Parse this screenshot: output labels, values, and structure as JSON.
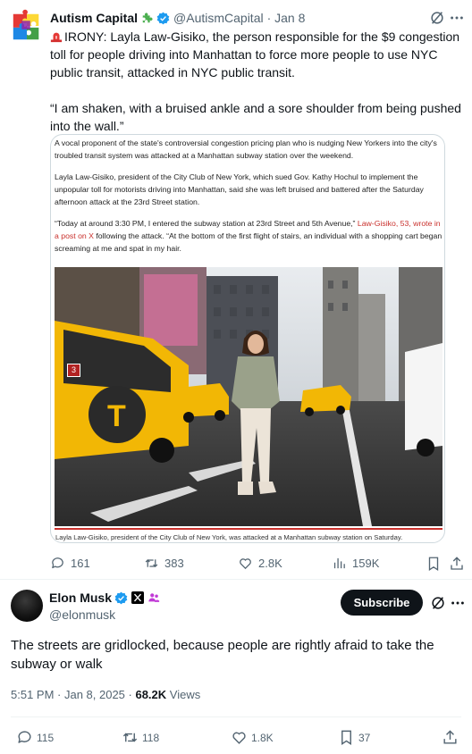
{
  "quoted_tweet": {
    "author_name": "Autism Capital",
    "author_emoji": "puzzle-piece-icon",
    "handle": "@AutismCapital",
    "date": "· Jan 8",
    "text_line1": "IRONY: Layla Law-Gisiko, the person responsible for the $9 congestion toll for people driving into Manhattan to force more people to use NYC public transit, attacked in NYC public transit.",
    "text_line2": "“I am shaken, with a bruised ankle and a sore shoulder from being pushed into the wall.”",
    "article": {
      "p1": "A vocal proponent of the state's controversial congestion pricing plan who is nudging New Yorkers into the city's troubled transit system was attacked at a Manhattan subway station over the weekend.",
      "p2": "Layla Law-Gisiko, president of the City Club of New York, which sued Gov. Kathy Hochul to implement the unpopular toll for motorists driving into Manhattan, said she was left bruised and battered after the Saturday afternoon attack at the 23rd Street station.",
      "p3_start": "“Today at around 3:30 PM, I entered the subway station at 23rd Street and 5th Avenue,”",
      "p3_link": "Law-Gisiko, 53, wrote in a post on X",
      "p3_end": "following the attack. “At the bottom of the first flight of stairs, an individual with a shopping cart began screaming at me and spat in my hair.",
      "photo_badge": "3",
      "caption": "Layla Law-Gisiko, president of the City Club of New York, was attacked at a Manhattan subway station on Saturday."
    },
    "stats": {
      "replies": "161",
      "reposts": "383",
      "likes": "2.8K",
      "views": "159K"
    }
  },
  "main_tweet": {
    "author_name": "Elon Musk",
    "handle": "@elonmusk",
    "subscribe_label": "Subscribe",
    "text": "The streets are gridlocked, because people are rightly afraid to take the subway or walk",
    "time": "5:51 PM · Jan 8, 2025 · ",
    "views_count": "68.2K",
    "views_label": " Views",
    "stats": {
      "replies": "115",
      "reposts": "118",
      "likes": "1.8K",
      "bookmarks": "37"
    }
  },
  "colors": {
    "text": "#0f1419",
    "secondary": "#536471",
    "verified_blue": "#1d9bf0",
    "link_red": "#c9302c",
    "taxi_yellow": "#f2b705"
  }
}
